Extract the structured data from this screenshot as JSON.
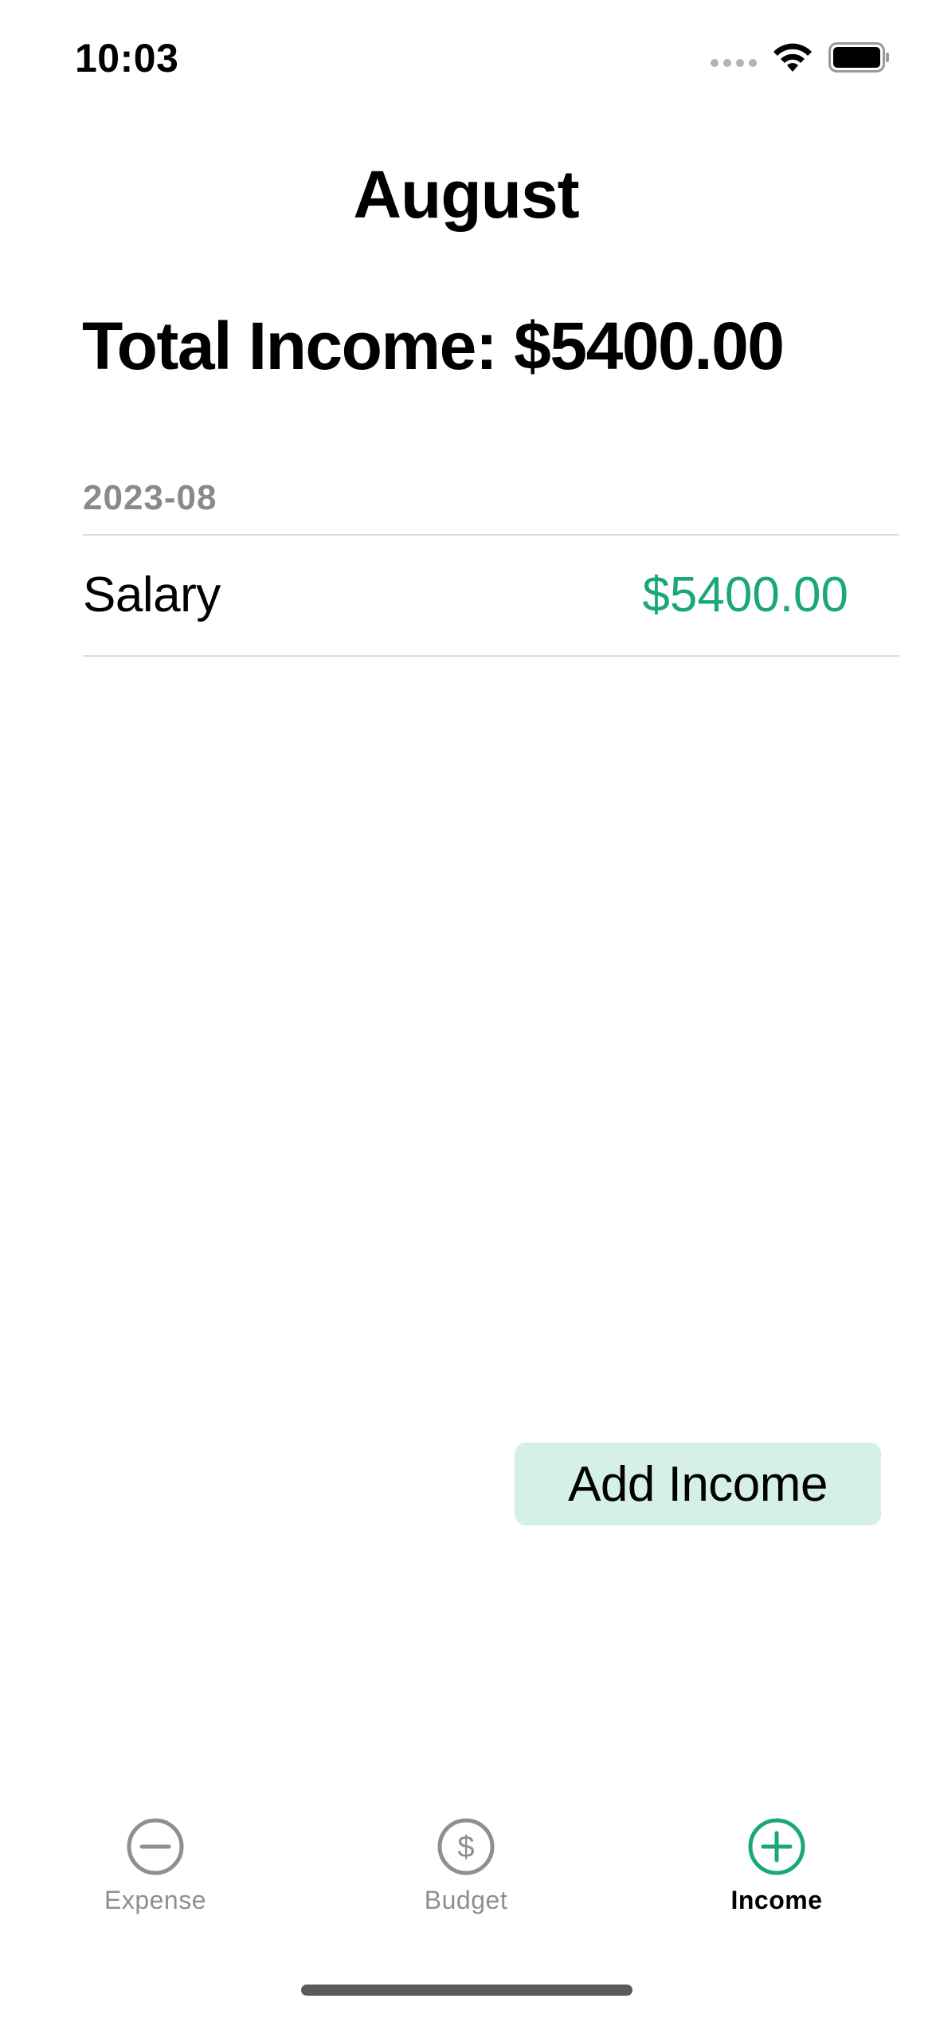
{
  "status_bar": {
    "time": "10:03",
    "icons": [
      "cellular-signal-icon",
      "wifi-icon",
      "battery-icon"
    ]
  },
  "header": {
    "title": "August"
  },
  "summary": {
    "total_income_text": "Total Income: $5400.00"
  },
  "list": {
    "section_header": "2023-08",
    "rows": [
      {
        "label": "Salary",
        "amount": "$5400.00"
      }
    ]
  },
  "actions": {
    "add_income_label": "Add Income"
  },
  "tab_bar": {
    "tabs": [
      {
        "label": "Expense",
        "icon": "minus-circle-icon",
        "active": false
      },
      {
        "label": "Budget",
        "icon": "dollar-circle-icon",
        "active": false
      },
      {
        "label": "Income",
        "icon": "plus-circle-icon",
        "active": true
      }
    ]
  },
  "colors": {
    "accent_green": "#1aa877",
    "button_background": "#d4f0e7",
    "inactive_gray": "#8e8e93",
    "section_header_gray": "#8a8a8e"
  }
}
